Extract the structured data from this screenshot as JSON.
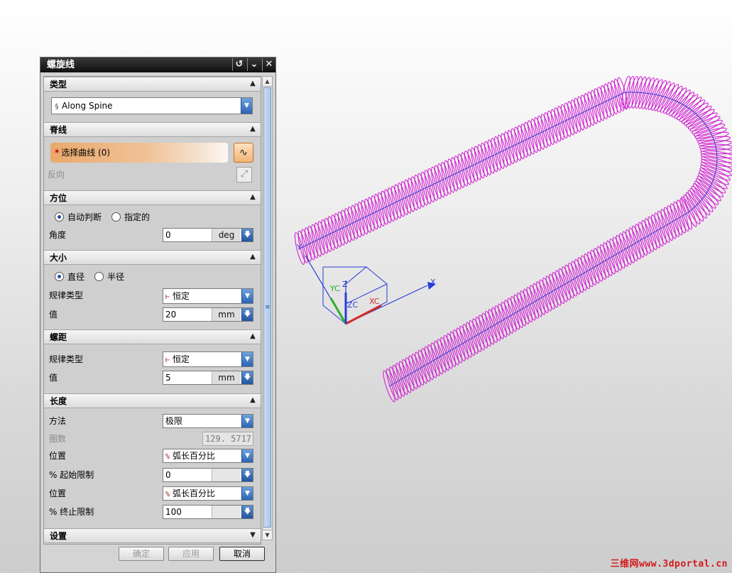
{
  "dialog": {
    "title": "螺旋线",
    "title_buttons": {
      "reset": "↺",
      "collapse": "⌄",
      "close": "✕"
    }
  },
  "type_section": {
    "header": "类型",
    "selected": "Along Spine",
    "icon": "helix-type-icon"
  },
  "spine_section": {
    "header": "脊线",
    "select_curve_label": "选择曲线 (0)",
    "required_marker": "*",
    "reverse_label": "反向"
  },
  "orientation_section": {
    "header": "方位",
    "radio_auto": "自动判断",
    "radio_specified": "指定的",
    "selected": "auto",
    "angle_label": "角度",
    "angle_value": "0",
    "angle_unit": "deg"
  },
  "size_section": {
    "header": "大小",
    "radio_diameter": "直径",
    "radio_radius": "半径",
    "selected": "diameter",
    "law_type_label": "规律类型",
    "law_type_value": "恒定",
    "value_label": "值",
    "value": "20",
    "unit": "mm"
  },
  "pitch_section": {
    "header": "螺距",
    "law_type_label": "规律类型",
    "law_type_value": "恒定",
    "value_label": "值",
    "value": "5",
    "unit": "mm"
  },
  "length_section": {
    "header": "长度",
    "method_label": "方法",
    "method_value": "极限",
    "turns_label": "圈数",
    "turns_value": "129. 5717",
    "position1_label": "位置",
    "position1_value": "弧长百分比",
    "start_limit_label": "% 起始限制",
    "start_limit_value": "0",
    "position2_label": "位置",
    "position2_value": "弧长百分比",
    "end_limit_label": "% 终止限制",
    "end_limit_value": "100"
  },
  "settings_section": {
    "header": "设置"
  },
  "footer": {
    "ok": "确定",
    "apply": "应用",
    "cancel": "取消"
  },
  "viewport": {
    "helix_color": "#d11ed1",
    "spine_color": "#2a3dd6",
    "axis_labels": {
      "x": "X",
      "y": "Y",
      "z": "Z",
      "xc": "XC",
      "yc": "YC",
      "zc": "ZC"
    }
  },
  "watermark": "三维网www.3dportal.cn"
}
